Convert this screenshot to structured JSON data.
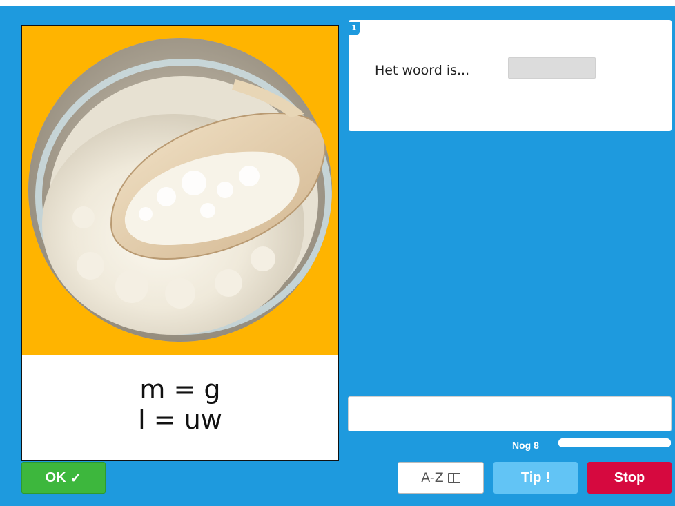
{
  "question": {
    "number": "1",
    "prompt": "Het woord is..."
  },
  "card": {
    "image_alt": "flour-in-wooden-scoop",
    "hint_line1": "m = g",
    "hint_line2": "l = uw"
  },
  "answer_input": {
    "value": "",
    "placeholder": ""
  },
  "progress": {
    "label": "Nog 8",
    "fill_fraction": 1.0
  },
  "buttons": {
    "ok_label": "OK",
    "ok_icon": "✓",
    "az_label": "A-Z",
    "az_icon": "book-icon",
    "tip_label": "Tip",
    "tip_icon": "!",
    "stop_label": "Stop"
  },
  "colors": {
    "stage_bg": "#1e9ade",
    "card_accent": "#ffb400",
    "ok": "#3db73d",
    "tip": "#62c4f5",
    "stop": "#d6093f"
  }
}
